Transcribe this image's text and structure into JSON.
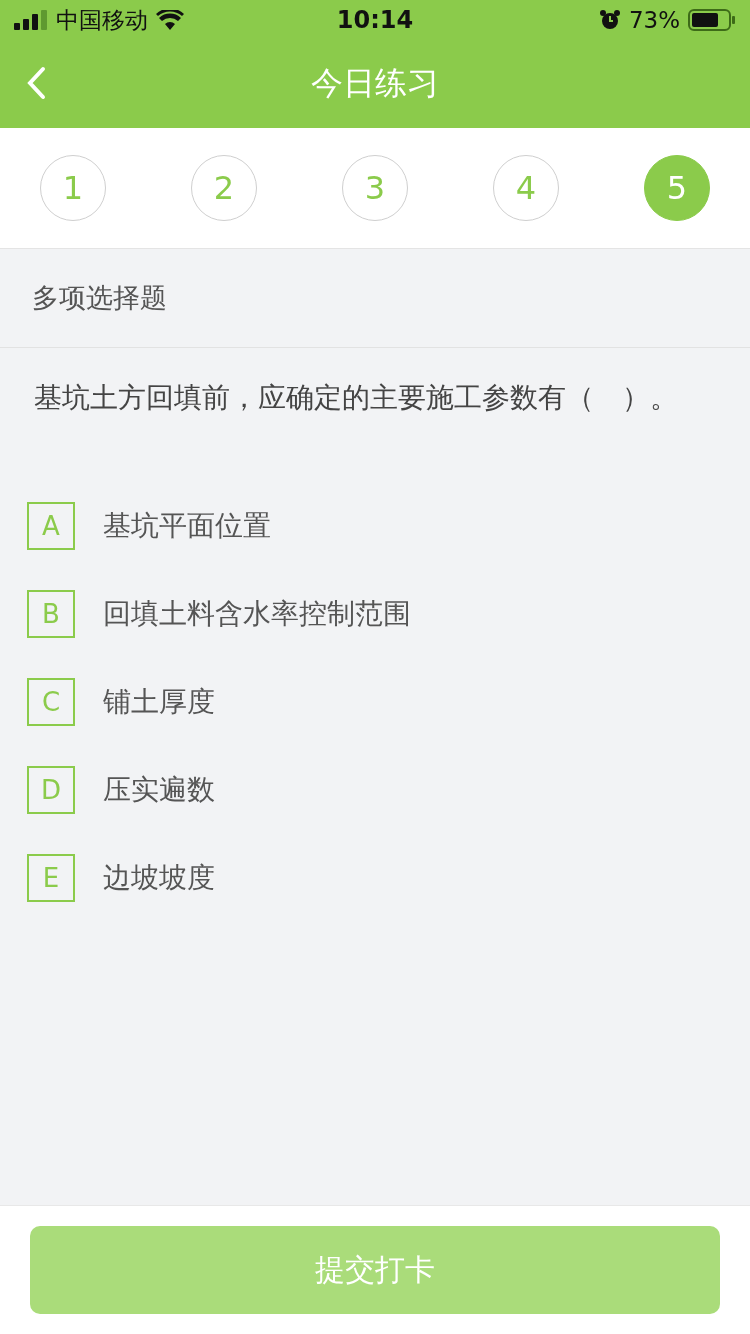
{
  "status_bar": {
    "carrier": "中国移动",
    "time": "10:14",
    "battery": "73%"
  },
  "nav": {
    "title": "今日练习"
  },
  "steps": [
    {
      "label": "1",
      "selected": false
    },
    {
      "label": "2",
      "selected": false
    },
    {
      "label": "3",
      "selected": false
    },
    {
      "label": "4",
      "selected": false
    },
    {
      "label": "5",
      "selected": true
    }
  ],
  "question": {
    "type_label": "多项选择题",
    "text": "基坑土方回填前，应确定的主要施工参数有（　）。",
    "options": [
      {
        "letter": "A",
        "text": "基坑平面位置",
        "checked": false
      },
      {
        "letter": "B",
        "text": "回填土料含水率控制范围",
        "checked": false
      },
      {
        "letter": "C",
        "text": "铺土厚度",
        "checked": false
      },
      {
        "letter": "D",
        "text": "压实遍数",
        "checked": false
      },
      {
        "letter": "E",
        "text": "边坡坡度",
        "checked": false
      }
    ]
  },
  "submit": {
    "label": "提交打卡",
    "disabled": true
  }
}
